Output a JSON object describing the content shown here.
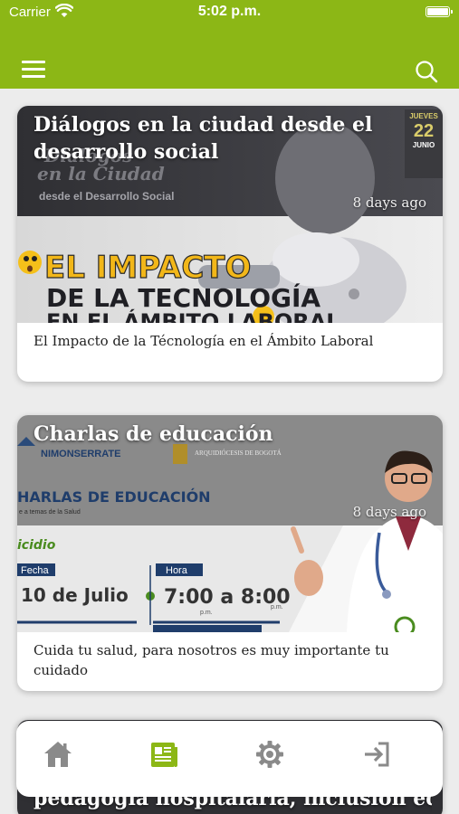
{
  "status_bar": {
    "carrier": "Carrier",
    "time": "5:02 p.m."
  },
  "header": {
    "menu_icon": "hamburger-menu-icon",
    "search_icon": "search-icon",
    "color": "#8cb716"
  },
  "posts": [
    {
      "title": "Diálogos en la ciudad desde el desarrollo social",
      "date": "8 days ago",
      "description": "El Impacto de la Técnología en el Ámbito Laboral",
      "image_text": {
        "line1": "Diálogos",
        "line2": "en la Ciudad",
        "line3": "desde el Desarrollo Social",
        "headline1": "EL IMPACTO",
        "headline2": "DE LA TECNOLOGÍA",
        "headline3": "EN EL ÁMBITO LABORAL",
        "badge_day": "JUEVES",
        "badge_num": "22",
        "badge_month": "JUNIO"
      }
    },
    {
      "title": "Charlas de educación",
      "date": "8 days ago",
      "description": "Cuida tu salud, para nosotros es muy importante tu cuidado",
      "image_text": {
        "org": "NIMONSERRATE",
        "arch": "ARQUIDIÓCESIS DE BOGOTÁ",
        "heading": "HARLAS DE EDUCACIÓN",
        "subheading": "e a temas de la Salud",
        "topic": "icidio",
        "fecha_label": "Fecha",
        "fecha_value": "10 de Julio",
        "hora_label": "Hora",
        "hora_value": "7:00 a 8:00",
        "pm1": "p.m.",
        "pm2": "p.m."
      }
    },
    {
      "title": "pedagogía hospitalaria, inclusión eq..."
    }
  ],
  "bottom_nav": [
    {
      "name": "home",
      "icon": "home-icon",
      "active": false
    },
    {
      "name": "news",
      "icon": "news-icon",
      "active": true
    },
    {
      "name": "settings",
      "icon": "gear-icon",
      "active": false
    },
    {
      "name": "logout",
      "icon": "logout-icon",
      "active": false
    }
  ],
  "colors": {
    "accent": "#8cb716",
    "inactive_icon": "#8a8a8a"
  }
}
